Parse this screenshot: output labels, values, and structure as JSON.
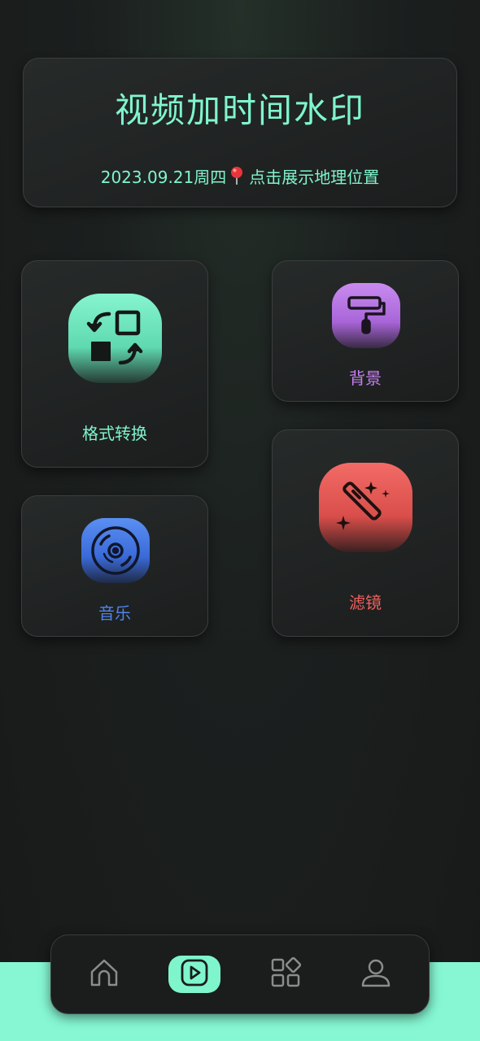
{
  "header": {
    "title": "视频加时间水印",
    "date": "2023.09.21周四",
    "location_prompt": "点击展示地理位置"
  },
  "tiles": {
    "format": {
      "label": "格式转换",
      "color": "#7ff5cc",
      "icon": "format-convert-icon"
    },
    "background": {
      "label": "背景",
      "color": "#c57ff0",
      "icon": "paint-roller-icon"
    },
    "music": {
      "label": "音乐",
      "color": "#4f83ea",
      "icon": "vinyl-disc-icon"
    },
    "filter": {
      "label": "滤镜",
      "color": "#f0605c",
      "icon": "magic-wand-icon"
    }
  },
  "nav": {
    "items": [
      {
        "icon": "home-icon",
        "active": false
      },
      {
        "icon": "play-icon",
        "active": true
      },
      {
        "icon": "apps-icon",
        "active": false
      },
      {
        "icon": "user-icon",
        "active": false
      }
    ],
    "accent": "#7ff5cc"
  }
}
